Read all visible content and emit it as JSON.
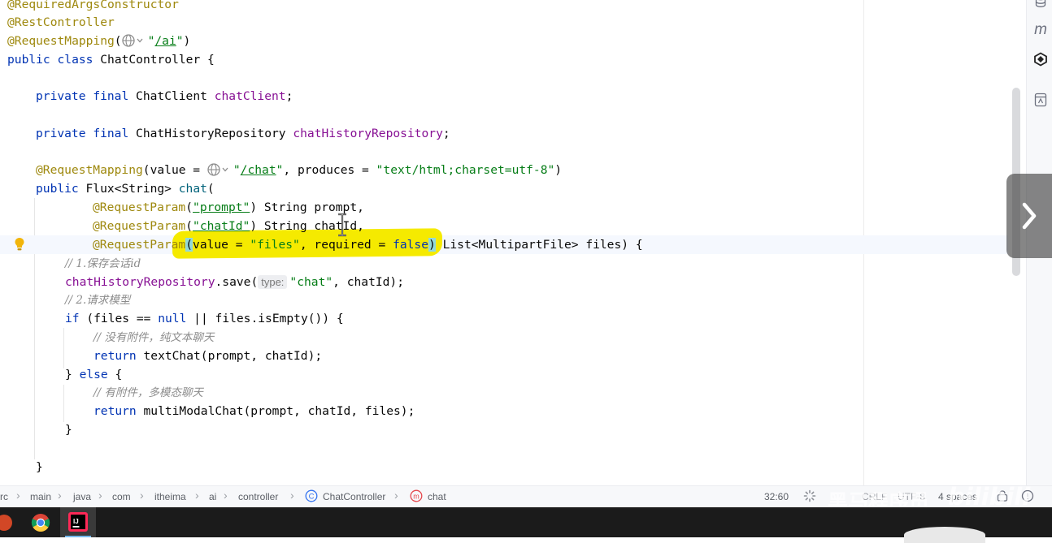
{
  "code": {
    "l1": "@RequiredArgsConstructor",
    "l2": "@RestController",
    "l3_ann": "@RequestMapping",
    "l3_url": "/ai",
    "l4_public": "public",
    "l4_class": "class",
    "l4_name": "ChatController {",
    "l5_private": "private",
    "l5_final": "final",
    "l5_type": "ChatClient",
    "l5_field": "chatClient",
    "l6_type": "ChatHistoryRepository",
    "l6_field": "chatHistoryRepository",
    "l7_ann": "@RequestMapping",
    "l7_value": "(value = ",
    "l7_url": "/chat",
    "l7_produces": ", produces = ",
    "l7_str": "\"text/html;charset=utf-8\"",
    "l8_public": "public",
    "l8_sig": "Flux<String>",
    "l8_method": "chat",
    "l9_ann": "@RequestParam",
    "l9_str": "\"prompt\"",
    "l9_rest": ") String prompt,",
    "l10_ann": "@RequestParam",
    "l10_str": "\"chatId\"",
    "l10_rest": ") String chatId,",
    "l11_ann": "@RequestParam",
    "l11_value": "value = ",
    "l11_str": "\"files\"",
    "l11_req": ", required = ",
    "l11_false": "false",
    "l11_rest": " List<MultipartFile> files) {",
    "c1": "// 1.保存会话id",
    "l12_field": "chatHistoryRepository",
    "l12_call": ".save(",
    "l12_hint": "type:",
    "l12_str": "\"chat\"",
    "l12_rest": ", chatId);",
    "c2": "// 2.请求模型",
    "l13_if": "if",
    "l13_open": " (files == ",
    "l13_null": "null",
    "l13_rest": " || files.isEmpty()) {",
    "c3": "// 没有附件，纯文本聊天",
    "l14_return": "return",
    "l14_rest": " textChat(prompt, chatId);",
    "l15_open": "} ",
    "l15_else": "else",
    "l15_rest": " {",
    "c4": "// 有附件，多模态聊天",
    "l16_return": "return",
    "l16_rest": " multiModalChat(prompt, chatId, files);",
    "l17": "}",
    "l18": "}"
  },
  "breadcrumb": {
    "items": [
      "rc",
      "main",
      "java",
      "com",
      "itheima",
      "ai",
      "controller",
      "ChatController",
      "chat"
    ]
  },
  "status": {
    "position": "32:60",
    "line_sep": "CRLF",
    "encoding": "UTF-8",
    "indent": "4 spaces"
  },
  "watermark": {
    "text": "黑马程序员",
    "logo": "bilibili"
  },
  "icons": [
    "database-icon",
    "maven-icon",
    "ai-assistant-icon",
    "notifications-icon",
    "lightbulb-icon",
    "chevron-right-icon",
    "loading-spinner-icon",
    "class-icon",
    "method-icon"
  ],
  "colors": {
    "annotation": "#9e880d",
    "keyword": "#0033b3",
    "string": "#067d17",
    "field": "#871094",
    "comment": "#8c8c8c",
    "highlight": "#f5ea00"
  }
}
